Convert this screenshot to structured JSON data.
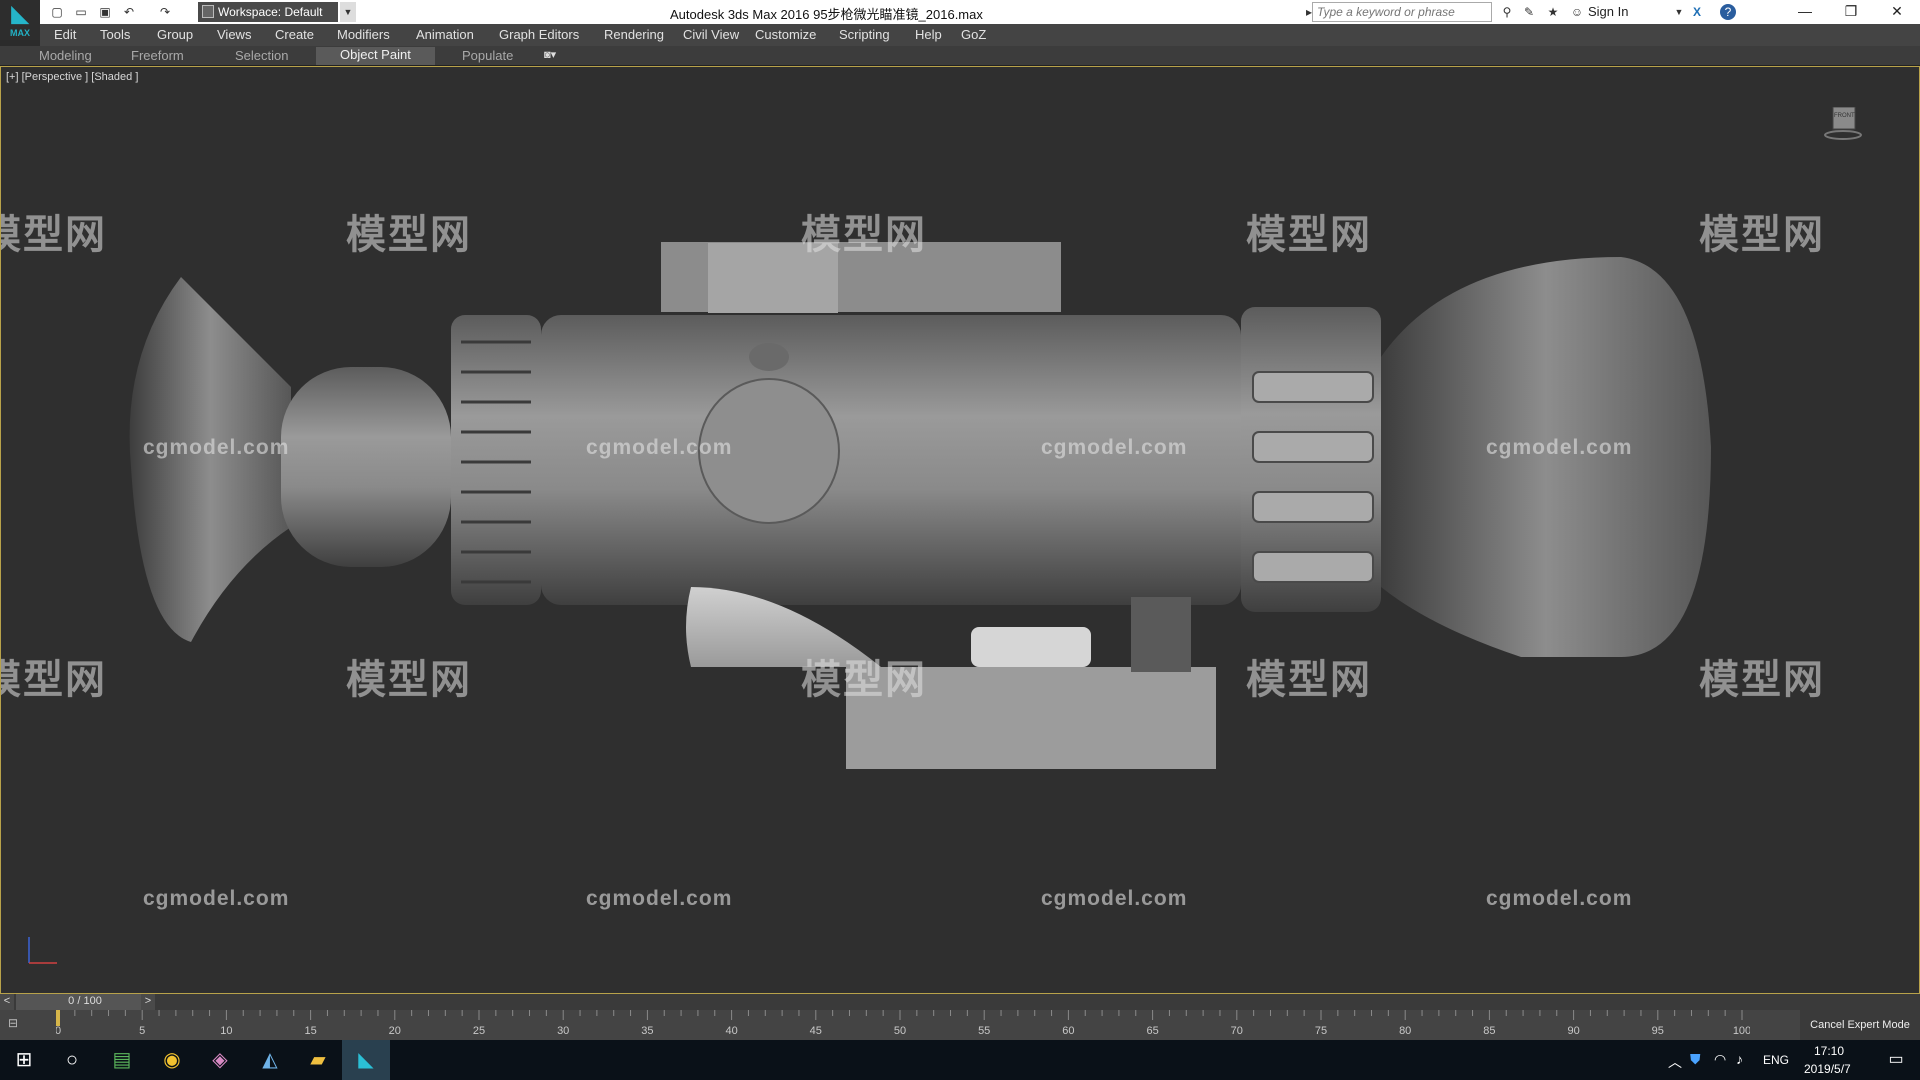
{
  "app": {
    "logo_text": "MAX",
    "window_title": "Autodesk 3ds Max 2016      95步枪微光瞄准镜_2016.max",
    "workspace_label": "Workspace: Default",
    "search_placeholder": "Type a keyword or phrase",
    "signin_label": "Sign In"
  },
  "menu": [
    "Edit",
    "Tools",
    "Group",
    "Views",
    "Create",
    "Modifiers",
    "Animation",
    "Graph Editors",
    "Rendering",
    "Civil View",
    "Customize",
    "Scripting",
    "Help",
    "GoZ"
  ],
  "ribbon_tabs": [
    "Modeling",
    "Freeform",
    "Selection",
    "Object Paint",
    "Populate"
  ],
  "ribbon_active": "Object Paint",
  "viewport": {
    "label": "[+] [Perspective ] [Shaded ]",
    "viewcube_label": "FRONT",
    "watermark_logo": "模型网",
    "watermark_url": "cgmodel.com"
  },
  "timeline": {
    "slider_text": "0 / 100",
    "ticks": [
      "0",
      "5",
      "10",
      "15",
      "20",
      "25",
      "30",
      "35",
      "40",
      "45",
      "50",
      "55",
      "60",
      "65",
      "70",
      "75",
      "80",
      "85",
      "90",
      "95",
      "100"
    ],
    "expert_mode_label": "Cancel Expert Mode"
  },
  "taskbar": {
    "language": "ENG",
    "time": "17:10",
    "date": "2019/5/7"
  },
  "colors": {
    "viewport_border": "#b8a24a",
    "accent": "#25b5c9",
    "taskbar_bg": "#0a1118"
  }
}
